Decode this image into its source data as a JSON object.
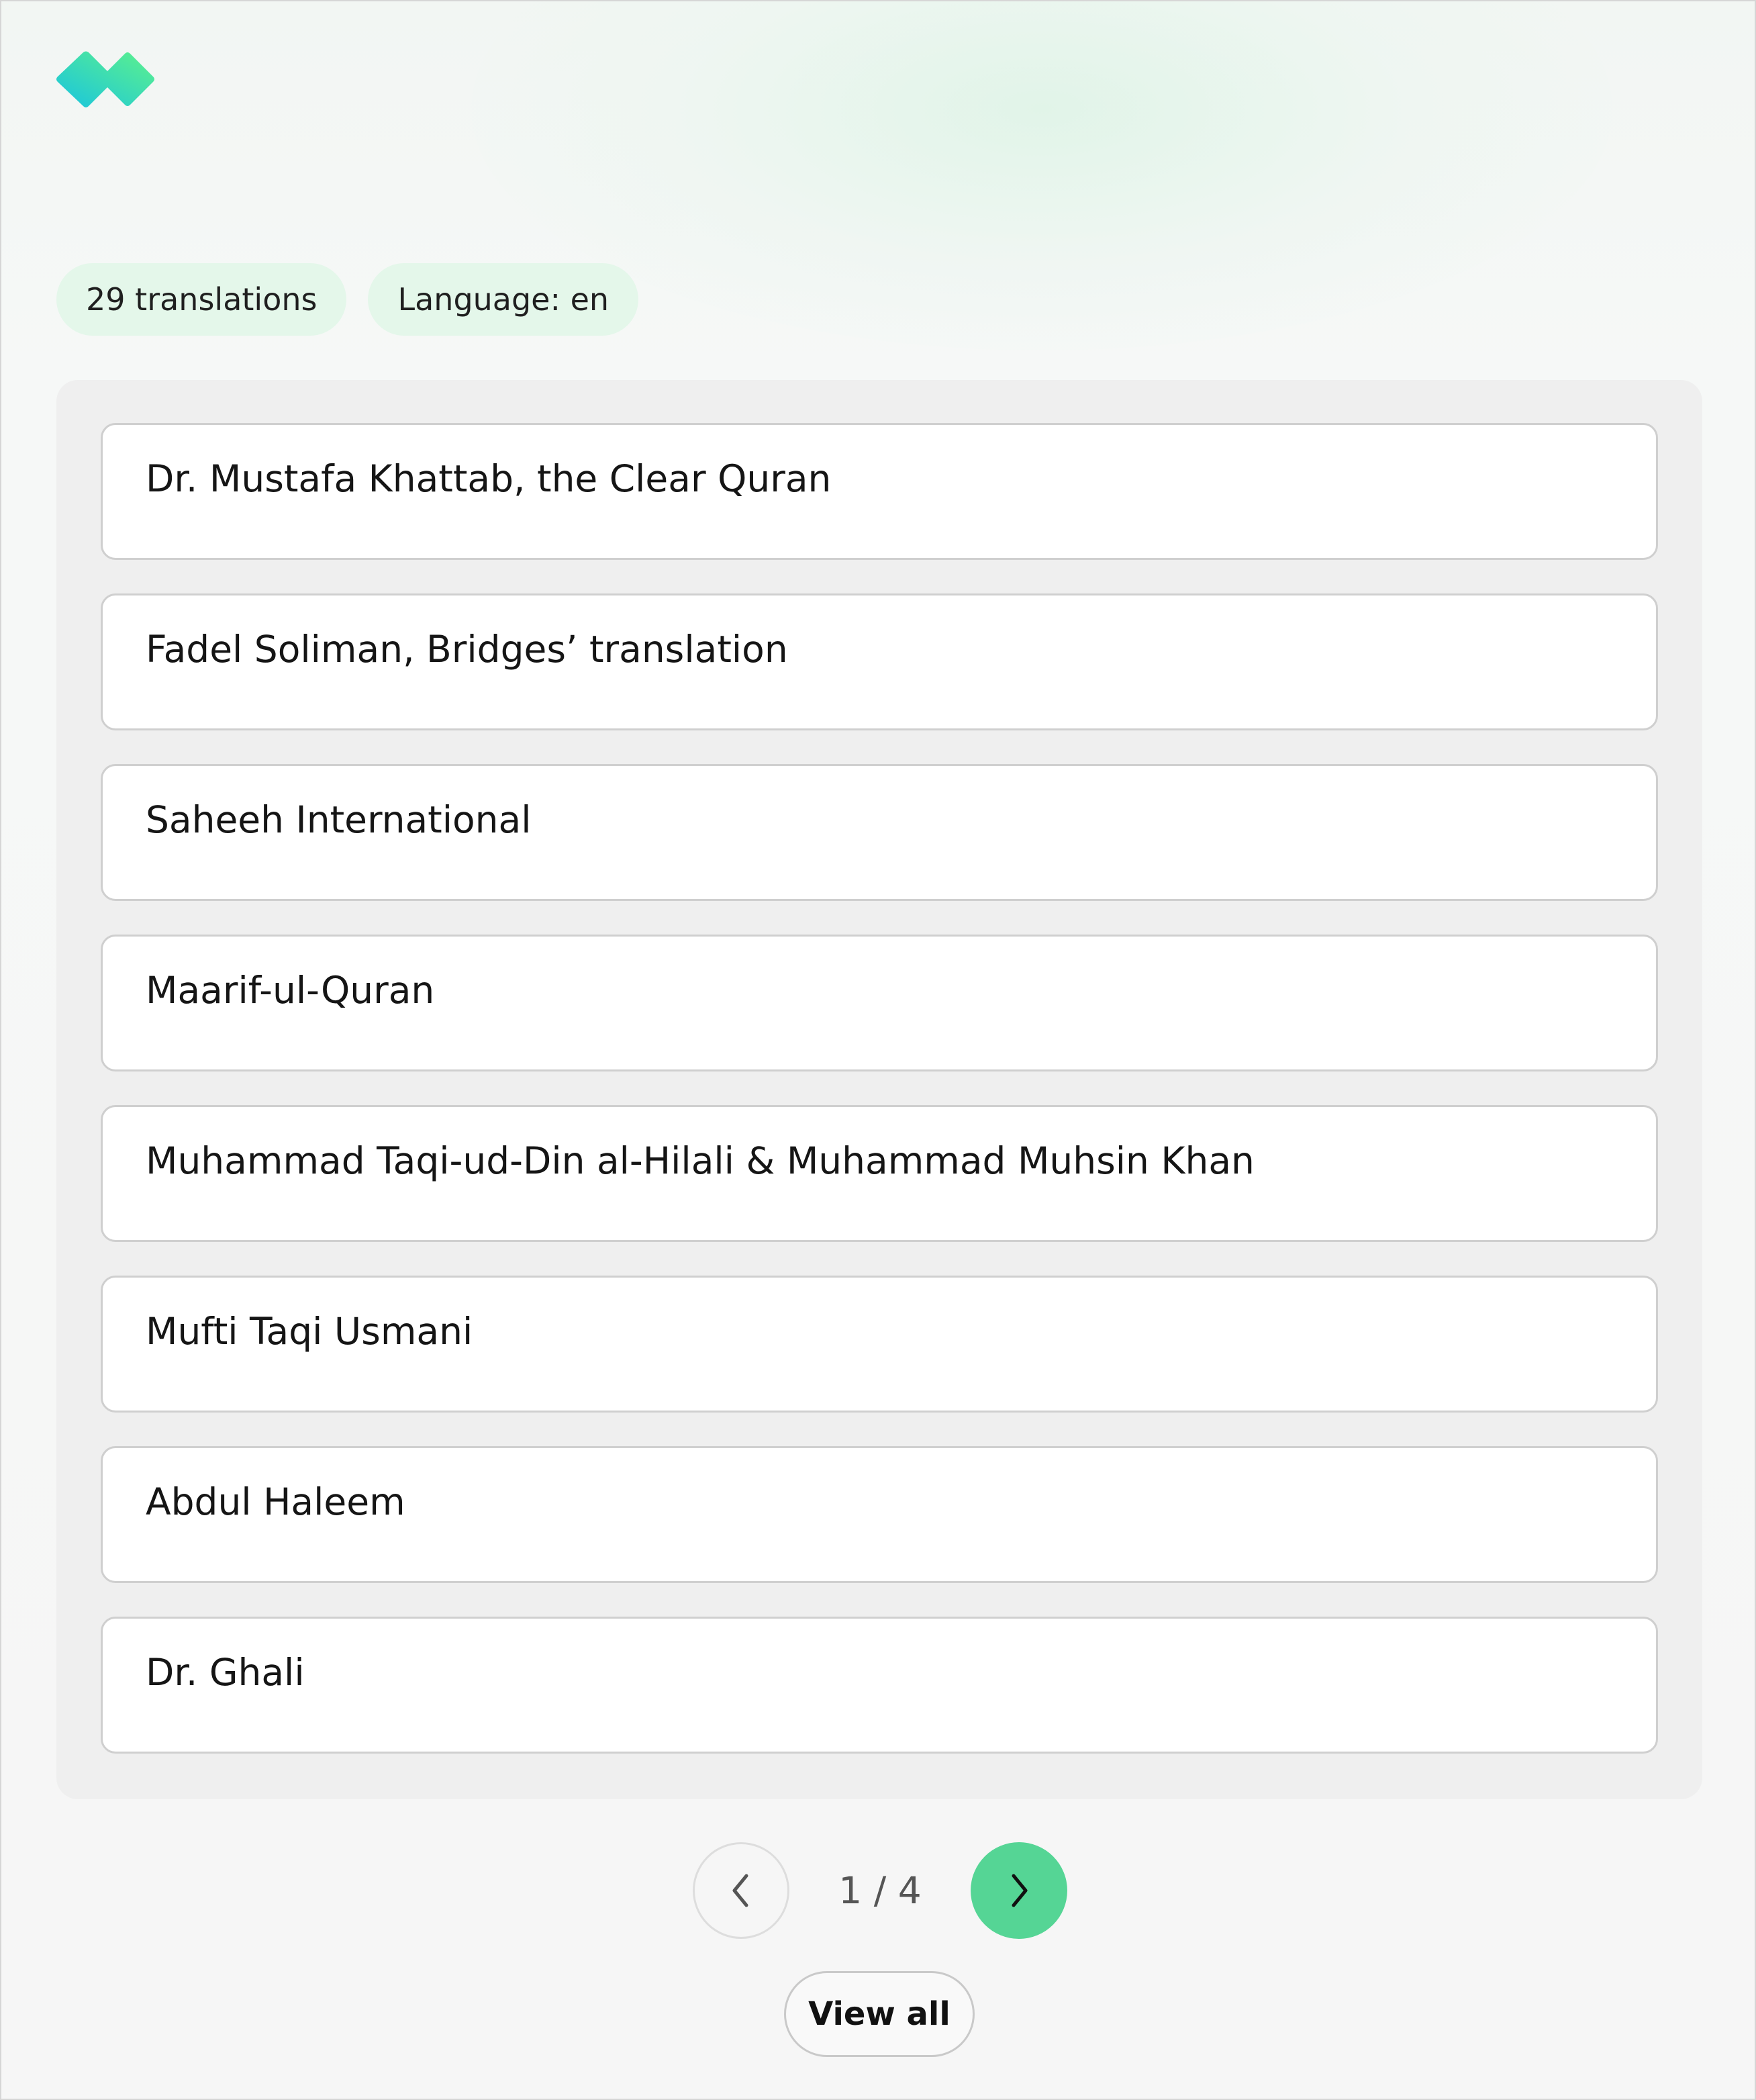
{
  "logo": {
    "icon": "brand-diamond-logo",
    "gradient": [
      "#18c4e0",
      "#5ef28a"
    ]
  },
  "chips": {
    "count": "29 translations",
    "language": "Language: en"
  },
  "translations": [
    "Dr. Mustafa Khattab, the Clear Quran",
    "Fadel Soliman, Bridges’ translation",
    "Saheeh International",
    "Maarif-ul-Quran",
    "Muhammad Taqi-ud-Din al-Hilali & Muhammad Muhsin Khan",
    "Mufti Taqi Usmani",
    "Abdul Haleem",
    "Dr. Ghali"
  ],
  "pagination": {
    "indicator": "1 / 4",
    "prev_icon": "chevron-left-icon",
    "next_icon": "chevron-right-icon"
  },
  "view_all_label": "View all",
  "colors": {
    "accent": "#55d595",
    "chip_bg": "#e4f7ea",
    "panel_bg": "#efefef"
  }
}
